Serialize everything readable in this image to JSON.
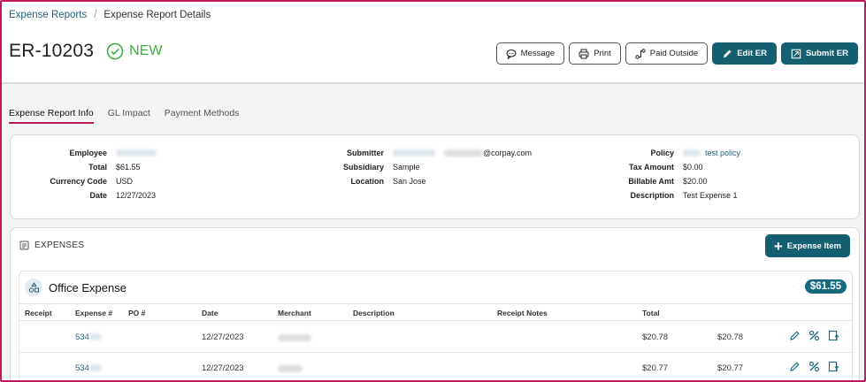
{
  "breadcrumb": {
    "parent": "Expense Reports",
    "current": "Expense Report Details"
  },
  "report": {
    "id": "ER-10203",
    "status": "NEW"
  },
  "actions": {
    "message": "Message",
    "print": "Print",
    "paid_outside": "Paid Outside",
    "edit": "Edit ER",
    "submit": "Submit ER"
  },
  "tabs": [
    {
      "label": "Expense Report Info"
    },
    {
      "label": "GL Impact"
    },
    {
      "label": "Payment Methods"
    }
  ],
  "info": {
    "left": [
      {
        "label": "Employee",
        "value": ""
      },
      {
        "label": "Total",
        "value": "$61.55"
      },
      {
        "label": "Currency Code",
        "value": "USD"
      },
      {
        "label": "Date",
        "value": "12/27/2023"
      }
    ],
    "middle": [
      {
        "label": "Submitter",
        "value": "@corpay.com"
      },
      {
        "label": "Subsidiary",
        "value": "Sample"
      },
      {
        "label": "Location",
        "value": "San Jose"
      }
    ],
    "right": [
      {
        "label": "Policy",
        "value": "test policy"
      },
      {
        "label": "Tax Amount",
        "value": "$0.00"
      },
      {
        "label": "Billable Amt",
        "value": "$20.00"
      },
      {
        "label": "Description",
        "value": "Test Expense 1"
      }
    ]
  },
  "expenses": {
    "section_title": "EXPENSES",
    "add_button": "Expense Item",
    "group": {
      "title": "Office Expense",
      "total": "$61.55"
    },
    "columns": [
      "Receipt",
      "Expense #",
      "PO #",
      "Date",
      "Merchant",
      "Description",
      "Receipt Notes",
      "Total"
    ],
    "rows": [
      {
        "expense_no": "534",
        "date": "12/27/2023",
        "total": "$20.78",
        "amount": "$20.78"
      },
      {
        "expense_no": "534",
        "date": "12/27/2023",
        "total": "$20.77",
        "amount": "$20.77"
      }
    ]
  }
}
